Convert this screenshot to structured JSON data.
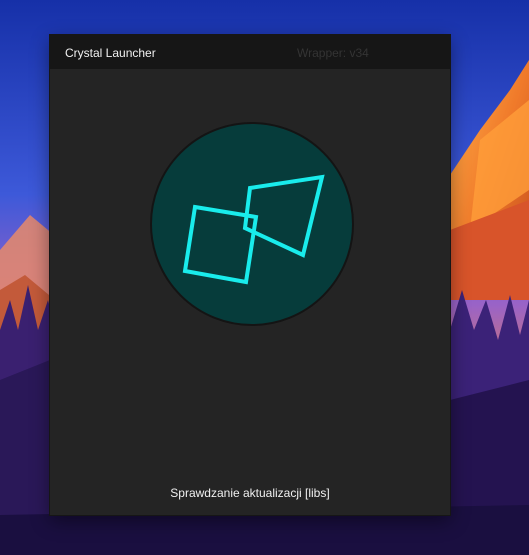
{
  "window": {
    "title": "Crystal Launcher",
    "version_label": "Wrapper: v34"
  },
  "logo": {
    "icon": "crystal-launcher-logo",
    "background_color": "#063c3b",
    "stroke_color": "#19ecec"
  },
  "status": {
    "text": "Sprawdzanie aktualizacji [libs]"
  },
  "colors": {
    "window_bg": "#242424",
    "titlebar_bg": "#161616",
    "text": "#f2f2f2",
    "version_text": "#343434"
  }
}
